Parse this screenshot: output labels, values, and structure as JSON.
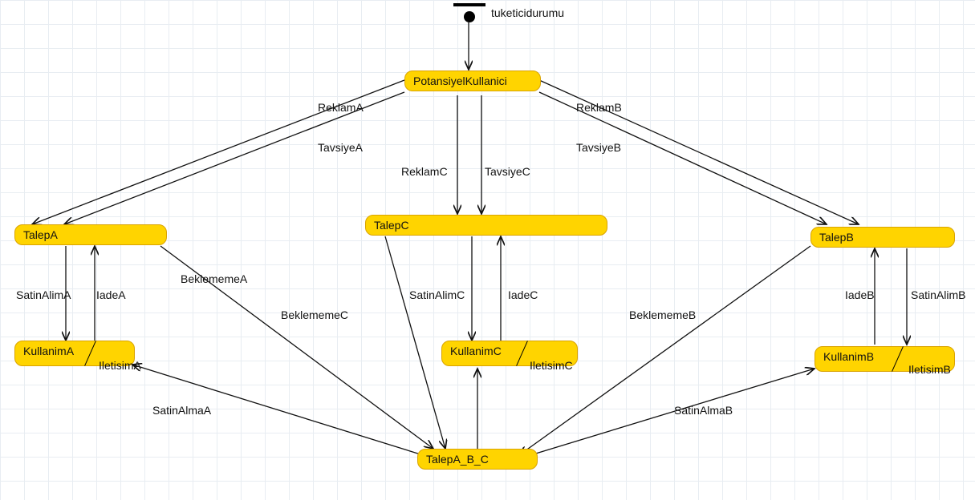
{
  "initial": {
    "label": "tuketicidurumu"
  },
  "nodes": {
    "potansiyelKullanici": "PotansiyelKullanici",
    "talepA": "TalepA",
    "talepB": "TalepB",
    "talepC": "TalepC",
    "kullanimA": "KullanimA",
    "kullanimB": "KullanimB",
    "kullanimC": "KullanimC",
    "talepABC": "TalepA_B_C"
  },
  "edgeLabels": {
    "reklamA": "ReklamA",
    "reklamB": "ReklamB",
    "reklamC": "ReklamC",
    "tavsiyeA": "TavsiyeA",
    "tavsiyeB": "TavsiyeB",
    "tavsiyeC": "TavsiyeC",
    "satinAlimA": "SatinAlimA",
    "satinAlimB": "SatinAlimB",
    "satinAlimC": "SatinAlimC",
    "iadeA": "IadeA",
    "iadeB": "IadeB",
    "iadeC": "IadeC",
    "iletisimA": "IletisimA",
    "iletisimB": "IletisimB",
    "iletisimC": "IletisimC",
    "beklememeA": "BeklememeA",
    "beklememeB": "BeklememeB",
    "beklememeC": "BeklememeC",
    "satinAlmaA": "SatinAlmaA",
    "satinAlmaB": "SatinAlmaB"
  }
}
